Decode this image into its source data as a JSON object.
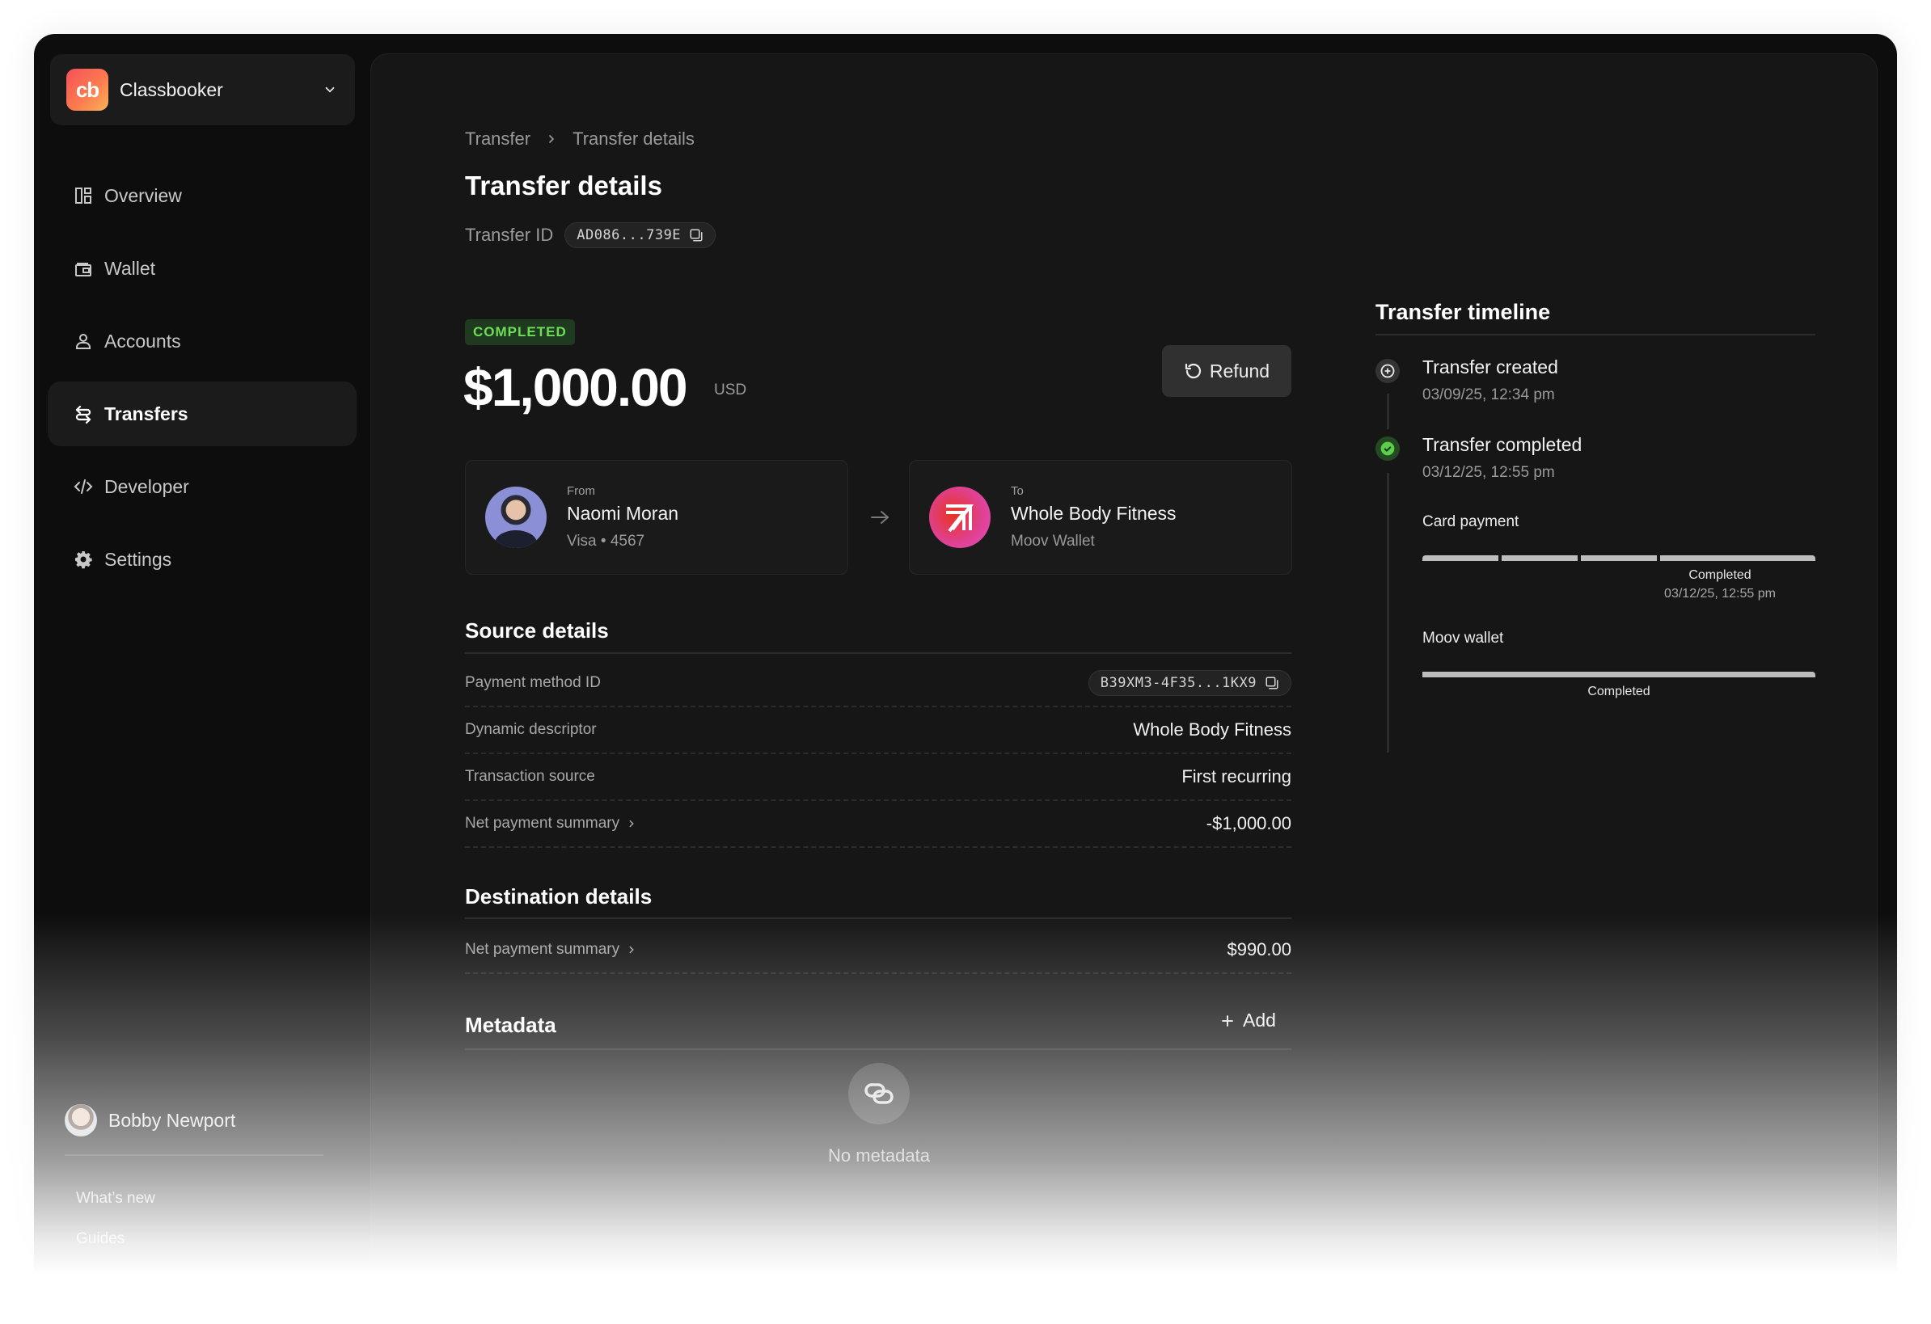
{
  "org": {
    "name": "Classbooker",
    "logo_text": "cb"
  },
  "sidebar": {
    "items": [
      {
        "label": "Overview",
        "icon": "layout-icon",
        "active": false
      },
      {
        "label": "Wallet",
        "icon": "wallet-icon",
        "active": false
      },
      {
        "label": "Accounts",
        "icon": "user-icon",
        "active": false
      },
      {
        "label": "Transfers",
        "icon": "transfer-arrows-icon",
        "active": true
      },
      {
        "label": "Developer",
        "icon": "code-icon",
        "active": false
      },
      {
        "label": "Settings",
        "icon": "gear-icon",
        "active": false
      }
    ],
    "user": {
      "name": "Bobby Newport"
    },
    "links": [
      "What’s new",
      "Guides"
    ]
  },
  "breadcrumb": {
    "parent": "Transfer",
    "current": "Transfer details"
  },
  "page": {
    "title": "Transfer details",
    "transfer_id_label": "Transfer ID",
    "transfer_id": "AD086...739E"
  },
  "summary": {
    "status": "COMPLETED",
    "status_color": "#6fdc5a",
    "amount": "$1,000.00",
    "currency": "USD",
    "refund_label": "Refund"
  },
  "from": {
    "role": "From",
    "name": "Naomi Moran",
    "detail": "Visa • 4567"
  },
  "to": {
    "role": "To",
    "name": "Whole Body Fitness",
    "detail": "Moov Wallet"
  },
  "source_details": {
    "title": "Source details",
    "rows": [
      {
        "label": "Payment method ID",
        "value": "B39XM3-4F35...1KX9",
        "type": "pill"
      },
      {
        "label": "Dynamic descriptor",
        "value": "Whole Body Fitness"
      },
      {
        "label": "Transaction source",
        "value": "First recurring"
      },
      {
        "label": "Net payment summary",
        "value": "-$1,000.00",
        "link": true
      }
    ]
  },
  "destination_details": {
    "title": "Destination details",
    "rows": [
      {
        "label": "Net payment summary",
        "value": "$990.00",
        "link": true
      }
    ]
  },
  "metadata": {
    "title": "Metadata",
    "add_label": "Add",
    "empty_text": "No metadata"
  },
  "timeline": {
    "title": "Transfer timeline",
    "events": [
      {
        "title": "Transfer created",
        "time": "03/09/25, 12:34 pm",
        "state": "created"
      },
      {
        "title": "Transfer completed",
        "time": "03/12/25, 12:55 pm",
        "state": "completed"
      }
    ],
    "rails": [
      {
        "title": "Card payment",
        "status": "Completed",
        "time": "03/12/25, 12:55 pm",
        "steps_completed": 4,
        "steps_total": 4
      },
      {
        "title": "Moov wallet",
        "status": "Completed",
        "steps_completed": 1,
        "steps_total": 1
      }
    ]
  }
}
